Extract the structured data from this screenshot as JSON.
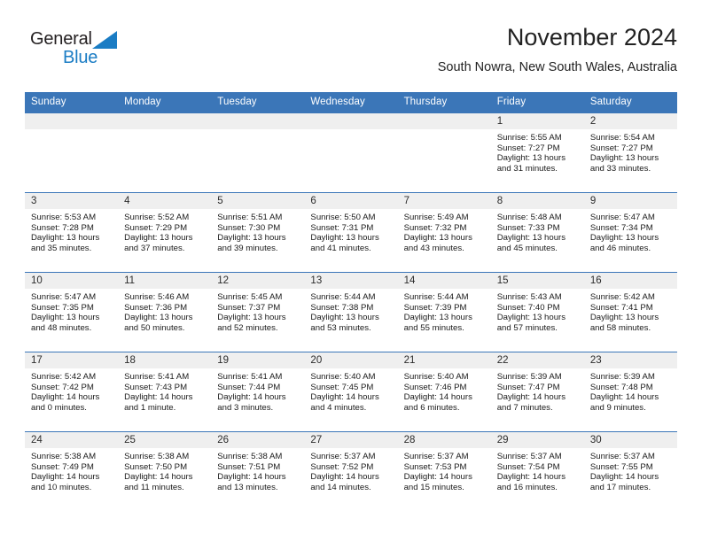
{
  "brand": {
    "name_top": "General",
    "name_bottom": "Blue",
    "triangle_icon": "blue-triangle-logo-mark",
    "color_text": "#231f20",
    "color_accent": "#1a7cc4"
  },
  "header": {
    "title": "November 2024",
    "subtitle": "South Nowra, New South Wales, Australia"
  },
  "theme": {
    "header_blue": "#3b76b8",
    "band_gray": "#efefef",
    "text_dark": "#1a1a1a"
  },
  "weekday_headers": [
    "Sunday",
    "Monday",
    "Tuesday",
    "Wednesday",
    "Thursday",
    "Friday",
    "Saturday"
  ],
  "weeks": [
    [
      {
        "day": "",
        "lines": []
      },
      {
        "day": "",
        "lines": []
      },
      {
        "day": "",
        "lines": []
      },
      {
        "day": "",
        "lines": []
      },
      {
        "day": "",
        "lines": []
      },
      {
        "day": "1",
        "lines": [
          "Sunrise: 5:55 AM",
          "Sunset: 7:27 PM",
          "Daylight: 13 hours",
          "and 31 minutes."
        ]
      },
      {
        "day": "2",
        "lines": [
          "Sunrise: 5:54 AM",
          "Sunset: 7:27 PM",
          "Daylight: 13 hours",
          "and 33 minutes."
        ]
      }
    ],
    [
      {
        "day": "3",
        "lines": [
          "Sunrise: 5:53 AM",
          "Sunset: 7:28 PM",
          "Daylight: 13 hours",
          "and 35 minutes."
        ]
      },
      {
        "day": "4",
        "lines": [
          "Sunrise: 5:52 AM",
          "Sunset: 7:29 PM",
          "Daylight: 13 hours",
          "and 37 minutes."
        ]
      },
      {
        "day": "5",
        "lines": [
          "Sunrise: 5:51 AM",
          "Sunset: 7:30 PM",
          "Daylight: 13 hours",
          "and 39 minutes."
        ]
      },
      {
        "day": "6",
        "lines": [
          "Sunrise: 5:50 AM",
          "Sunset: 7:31 PM",
          "Daylight: 13 hours",
          "and 41 minutes."
        ]
      },
      {
        "day": "7",
        "lines": [
          "Sunrise: 5:49 AM",
          "Sunset: 7:32 PM",
          "Daylight: 13 hours",
          "and 43 minutes."
        ]
      },
      {
        "day": "8",
        "lines": [
          "Sunrise: 5:48 AM",
          "Sunset: 7:33 PM",
          "Daylight: 13 hours",
          "and 45 minutes."
        ]
      },
      {
        "day": "9",
        "lines": [
          "Sunrise: 5:47 AM",
          "Sunset: 7:34 PM",
          "Daylight: 13 hours",
          "and 46 minutes."
        ]
      }
    ],
    [
      {
        "day": "10",
        "lines": [
          "Sunrise: 5:47 AM",
          "Sunset: 7:35 PM",
          "Daylight: 13 hours",
          "and 48 minutes."
        ]
      },
      {
        "day": "11",
        "lines": [
          "Sunrise: 5:46 AM",
          "Sunset: 7:36 PM",
          "Daylight: 13 hours",
          "and 50 minutes."
        ]
      },
      {
        "day": "12",
        "lines": [
          "Sunrise: 5:45 AM",
          "Sunset: 7:37 PM",
          "Daylight: 13 hours",
          "and 52 minutes."
        ]
      },
      {
        "day": "13",
        "lines": [
          "Sunrise: 5:44 AM",
          "Sunset: 7:38 PM",
          "Daylight: 13 hours",
          "and 53 minutes."
        ]
      },
      {
        "day": "14",
        "lines": [
          "Sunrise: 5:44 AM",
          "Sunset: 7:39 PM",
          "Daylight: 13 hours",
          "and 55 minutes."
        ]
      },
      {
        "day": "15",
        "lines": [
          "Sunrise: 5:43 AM",
          "Sunset: 7:40 PM",
          "Daylight: 13 hours",
          "and 57 minutes."
        ]
      },
      {
        "day": "16",
        "lines": [
          "Sunrise: 5:42 AM",
          "Sunset: 7:41 PM",
          "Daylight: 13 hours",
          "and 58 minutes."
        ]
      }
    ],
    [
      {
        "day": "17",
        "lines": [
          "Sunrise: 5:42 AM",
          "Sunset: 7:42 PM",
          "Daylight: 14 hours",
          "and 0 minutes."
        ]
      },
      {
        "day": "18",
        "lines": [
          "Sunrise: 5:41 AM",
          "Sunset: 7:43 PM",
          "Daylight: 14 hours",
          "and 1 minute."
        ]
      },
      {
        "day": "19",
        "lines": [
          "Sunrise: 5:41 AM",
          "Sunset: 7:44 PM",
          "Daylight: 14 hours",
          "and 3 minutes."
        ]
      },
      {
        "day": "20",
        "lines": [
          "Sunrise: 5:40 AM",
          "Sunset: 7:45 PM",
          "Daylight: 14 hours",
          "and 4 minutes."
        ]
      },
      {
        "day": "21",
        "lines": [
          "Sunrise: 5:40 AM",
          "Sunset: 7:46 PM",
          "Daylight: 14 hours",
          "and 6 minutes."
        ]
      },
      {
        "day": "22",
        "lines": [
          "Sunrise: 5:39 AM",
          "Sunset: 7:47 PM",
          "Daylight: 14 hours",
          "and 7 minutes."
        ]
      },
      {
        "day": "23",
        "lines": [
          "Sunrise: 5:39 AM",
          "Sunset: 7:48 PM",
          "Daylight: 14 hours",
          "and 9 minutes."
        ]
      }
    ],
    [
      {
        "day": "24",
        "lines": [
          "Sunrise: 5:38 AM",
          "Sunset: 7:49 PM",
          "Daylight: 14 hours",
          "and 10 minutes."
        ]
      },
      {
        "day": "25",
        "lines": [
          "Sunrise: 5:38 AM",
          "Sunset: 7:50 PM",
          "Daylight: 14 hours",
          "and 11 minutes."
        ]
      },
      {
        "day": "26",
        "lines": [
          "Sunrise: 5:38 AM",
          "Sunset: 7:51 PM",
          "Daylight: 14 hours",
          "and 13 minutes."
        ]
      },
      {
        "day": "27",
        "lines": [
          "Sunrise: 5:37 AM",
          "Sunset: 7:52 PM",
          "Daylight: 14 hours",
          "and 14 minutes."
        ]
      },
      {
        "day": "28",
        "lines": [
          "Sunrise: 5:37 AM",
          "Sunset: 7:53 PM",
          "Daylight: 14 hours",
          "and 15 minutes."
        ]
      },
      {
        "day": "29",
        "lines": [
          "Sunrise: 5:37 AM",
          "Sunset: 7:54 PM",
          "Daylight: 14 hours",
          "and 16 minutes."
        ]
      },
      {
        "day": "30",
        "lines": [
          "Sunrise: 5:37 AM",
          "Sunset: 7:55 PM",
          "Daylight: 14 hours",
          "and 17 minutes."
        ]
      }
    ]
  ]
}
